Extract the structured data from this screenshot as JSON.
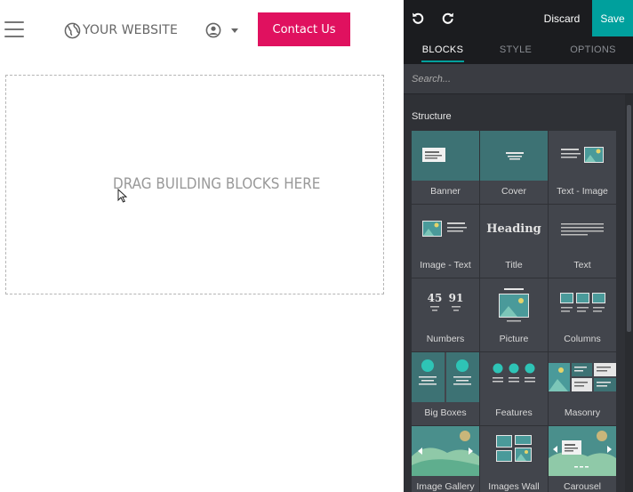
{
  "site": {
    "logo_text": "YOUR WEBSITE",
    "contact_label": "Contact Us",
    "dropzone_text": "DRAG BUILDING BLOCKS HERE"
  },
  "editor": {
    "discard_label": "Discard",
    "save_label": "Save",
    "tabs": [
      {
        "label": "BLOCKS",
        "active": true
      },
      {
        "label": "STYLE",
        "active": false
      },
      {
        "label": "OPTIONS",
        "active": false
      }
    ],
    "search_placeholder": "Search...",
    "section_title": "Structure",
    "blocks": [
      {
        "label": "Banner",
        "icon": "banner-icon"
      },
      {
        "label": "Cover",
        "icon": "cover-icon"
      },
      {
        "label": "Text - Image",
        "icon": "text-image-icon"
      },
      {
        "label": "Image - Text",
        "icon": "image-text-icon"
      },
      {
        "label": "Title",
        "icon": "title-icon",
        "thumb_text": "Heading"
      },
      {
        "label": "Text",
        "icon": "text-icon"
      },
      {
        "label": "Numbers",
        "icon": "numbers-icon",
        "thumb_values": [
          "45",
          "91"
        ]
      },
      {
        "label": "Picture",
        "icon": "picture-icon"
      },
      {
        "label": "Columns",
        "icon": "columns-icon"
      },
      {
        "label": "Big Boxes",
        "icon": "big-boxes-icon"
      },
      {
        "label": "Features",
        "icon": "features-icon"
      },
      {
        "label": "Masonry",
        "icon": "masonry-icon"
      },
      {
        "label": "Image Gallery",
        "icon": "image-gallery-icon"
      },
      {
        "label": "Images Wall",
        "icon": "images-wall-icon"
      },
      {
        "label": "Carousel",
        "icon": "carousel-icon"
      }
    ]
  },
  "colors": {
    "accent": "#00a09d",
    "brand_button": "#e0115f",
    "panel_bg": "#2f3136",
    "topbar_bg": "#1b1c1f"
  }
}
